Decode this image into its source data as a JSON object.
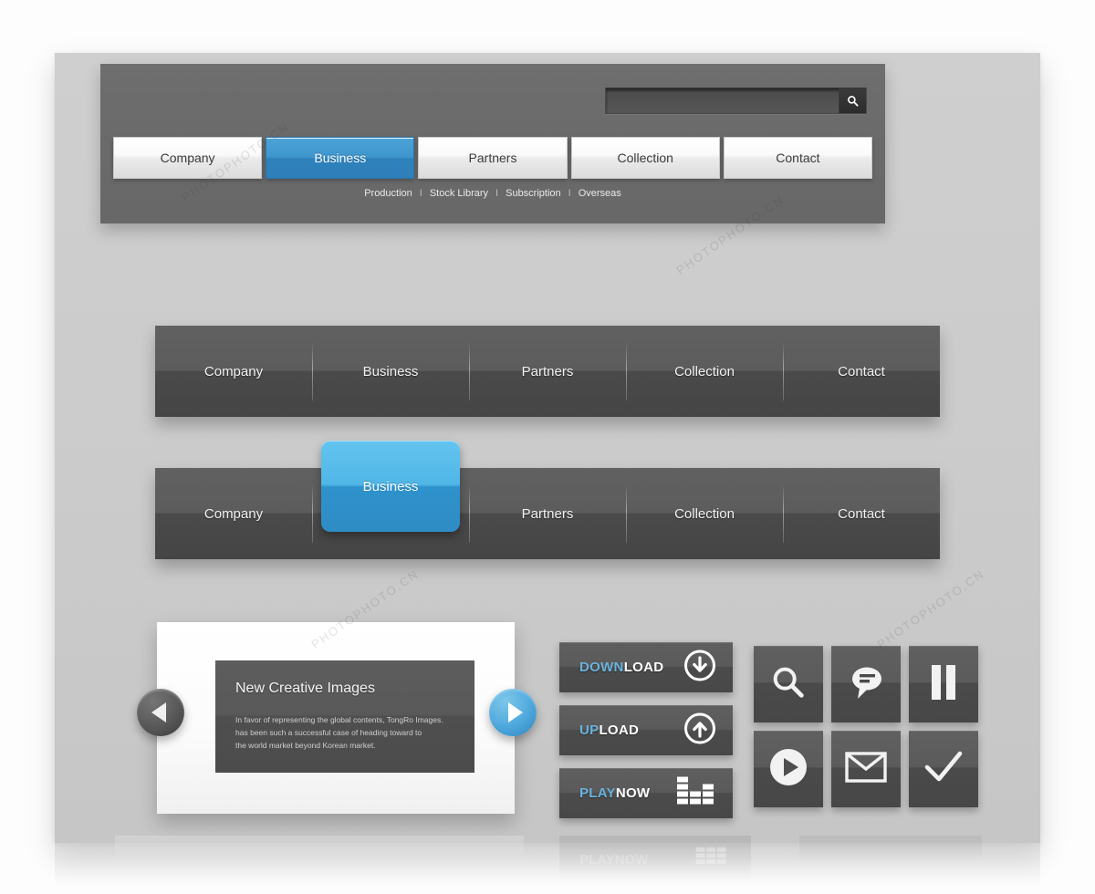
{
  "search": {
    "value": "",
    "placeholder": "",
    "icon": "search-icon"
  },
  "top_nav": {
    "tabs": [
      {
        "label": "Company",
        "active": false
      },
      {
        "label": "Business",
        "active": true
      },
      {
        "label": "Partners",
        "active": false
      },
      {
        "label": "Collection",
        "active": false
      },
      {
        "label": "Contact",
        "active": false
      }
    ],
    "subnav": {
      "items": [
        "Production",
        "Stock Library",
        "Subscription",
        "Overseas"
      ],
      "separator": "I"
    }
  },
  "dark_nav_plain": {
    "items": [
      "Company",
      "Business",
      "Partners",
      "Collection",
      "Contact"
    ]
  },
  "dark_nav_active": {
    "items": [
      "Company",
      "Business",
      "Partners",
      "Collection",
      "Contact"
    ],
    "active_index": 1,
    "active_label": "Business"
  },
  "slider": {
    "title": "New Creative Images",
    "body": "In favor of representing the global contents, TongRo Images.\nhas been such a successful case of heading toward to\nthe world market beyond Korean market.",
    "prev_label": "Previous slide",
    "next_label": "Next slide",
    "prev_icon": "triangle-left-icon",
    "next_icon": "triangle-right-icon"
  },
  "actions": [
    {
      "label_accent": "DOWN",
      "label_rest": "LOAD",
      "icon": "arrow-down-circle-icon"
    },
    {
      "label_accent": "UP",
      "label_rest": "LOAD",
      "icon": "arrow-up-circle-icon"
    },
    {
      "label_accent": "PLAY",
      "label_rest": "NOW",
      "icon": "equalizer-icon"
    }
  ],
  "icon_grid": [
    {
      "name": "search-icon"
    },
    {
      "name": "chat-bubble-icon"
    },
    {
      "name": "pause-icon"
    },
    {
      "name": "play-circle-icon"
    },
    {
      "name": "envelope-icon"
    },
    {
      "name": "check-icon"
    }
  ],
  "ghost": {
    "label_accent": "PLAY",
    "label_rest": "NOW"
  },
  "colors": {
    "accent_blue": "#4ca3d8",
    "accent_blue_light": "#64c4ef",
    "label_blue": "#6ab3dd",
    "bar_gray": "#6a6a6a",
    "dark_bar_top": "#616161",
    "dark_bar_bottom": "#454545",
    "board_gray": "#cbcbcb"
  },
  "watermarks": [
    "PHOTOPHOTO.CN",
    "PHOTOPHOTO.CN",
    "PHOTOPHOTO.CN",
    "PHOTOPHOTO.CN"
  ]
}
